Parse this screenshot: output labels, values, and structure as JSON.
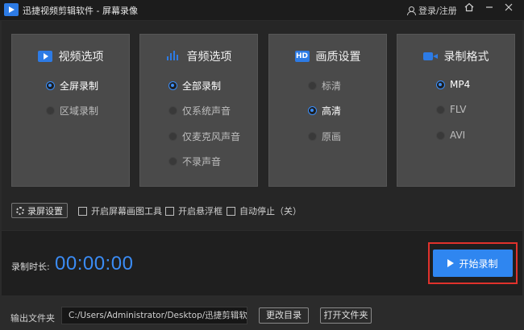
{
  "app": {
    "title": "迅捷视频剪辑软件 - 屏幕录像",
    "login": "登录/注册"
  },
  "cards": {
    "video": {
      "title": "视频选项",
      "icon": "video-play-icon",
      "options": [
        "全屏录制",
        "区域录制"
      ],
      "selected": "全屏录制"
    },
    "audio": {
      "title": "音频选项",
      "icon": "audio-wave-icon",
      "options": [
        "全部录制",
        "仅系统声音",
        "仅麦克风声音",
        "不录声音"
      ],
      "selected": "全部录制"
    },
    "quality": {
      "title": "画质设置",
      "icon": "hd-icon",
      "icon_text": "HD",
      "options": [
        "标清",
        "高清",
        "原画"
      ],
      "selected": "高清"
    },
    "format": {
      "title": "录制格式",
      "icon": "camera-icon",
      "options": [
        "MP4",
        "FLV",
        "AVI"
      ],
      "selected": "MP4"
    }
  },
  "toolbar": {
    "screen_settings": "录屏设置",
    "check1": "开启屏幕画图工具",
    "check2": "开启悬浮框",
    "check3": "自动停止（关）"
  },
  "record": {
    "duration_label": "录制时长:",
    "timer": "00:00:00",
    "start_label": "开始录制"
  },
  "output": {
    "label": "输出文件夹",
    "path": "C:/Users/Administrator/Desktop/迅捷剪辑软件",
    "change_dir": "更改目录",
    "open_folder": "打开文件夹"
  },
  "colors": {
    "accent": "#2f86f0",
    "highlight_border": "#e0322c"
  }
}
